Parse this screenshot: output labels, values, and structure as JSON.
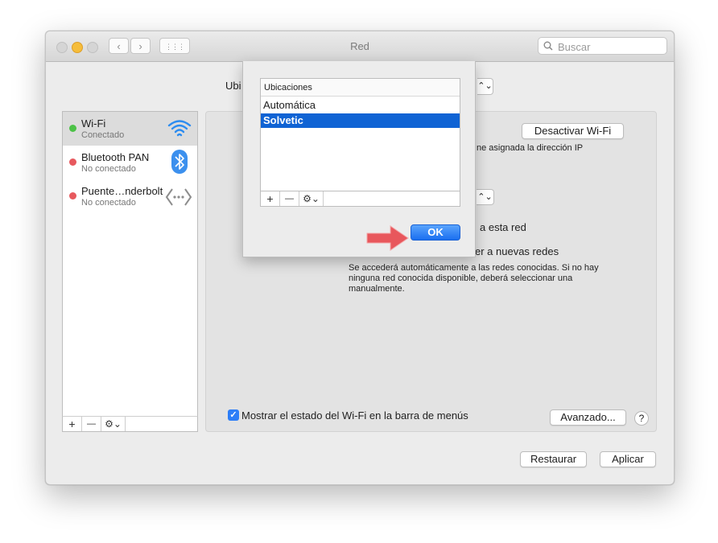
{
  "window": {
    "title": "Red",
    "search_placeholder": "Buscar"
  },
  "toolbar": {
    "back_glyph": "‹",
    "forward_glyph": "›",
    "grid_glyph": "⋮⋮⋮"
  },
  "location": {
    "label_partial": "Ubi",
    "select_arrow": "⌃⌄"
  },
  "sidebar": {
    "items": [
      {
        "name": "Wi-Fi",
        "status": "Conectado",
        "status_color": "#4cc247",
        "icon": "wifi-icon"
      },
      {
        "name": "Bluetooth PAN",
        "status": "No conectado",
        "status_color": "#e7595e",
        "icon": "bluetooth-icon"
      },
      {
        "name": "Puente…nderbolt",
        "status": "No conectado",
        "status_color": "#e7595e",
        "icon": "thunderbolt-bridge-icon"
      }
    ],
    "add": "+",
    "remove": "—",
    "gear": "⚙⌄"
  },
  "panel": {
    "deactivate_button": "Desactivar Wi-Fi",
    "ip_text_partial": "ne asignada la dirección IP",
    "network_select_arrow": "⌃⌄",
    "join_text_partial": "a esta red",
    "ask_text_partial": "er a nuevas redes",
    "help_text": "Se accederá automáticamente a las redes conocidas. Si no hay ninguna red conocida disponible, deberá seleccionar una manualmente.",
    "show_status_label": "Mostrar el estado del Wi-Fi en la barra de menús",
    "show_status_checked": true,
    "advanced_button": "Avanzado...",
    "help_button": "?"
  },
  "footer": {
    "restore_button": "Restaurar",
    "apply_button": "Aplicar"
  },
  "sheet": {
    "header": "Ubicaciones",
    "locations": [
      {
        "label": "Automática",
        "selected": false
      },
      {
        "label": "Solvetic",
        "selected": true
      }
    ],
    "add": "+",
    "remove": "—",
    "gear": "⚙⌄",
    "ok_button": "OK"
  },
  "colors": {
    "accent": "#0f63d4",
    "arrow": "#e8575c"
  }
}
